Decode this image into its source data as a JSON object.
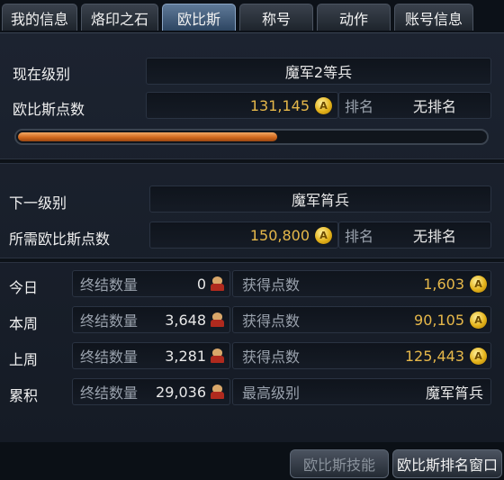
{
  "tabs": [
    {
      "label": "我的信息"
    },
    {
      "label": "烙印之石"
    },
    {
      "label": "欧比斯"
    },
    {
      "label": "称号"
    },
    {
      "label": "动作"
    },
    {
      "label": "账号信息"
    }
  ],
  "active_tab": "欧比斯",
  "current": {
    "level_label": "现在级别",
    "level_value": "魔军2等兵",
    "points_label": "欧比斯点数",
    "points_value": "131,145",
    "rank_label": "排名",
    "rank_value": "无排名",
    "progress_fraction": 0.555
  },
  "next": {
    "level_label": "下一级别",
    "level_value": "魔军筲兵",
    "points_label": "所需欧比斯点数",
    "points_value": "150,800",
    "rank_label": "排名",
    "rank_value": "无排名"
  },
  "stats": {
    "kills_label": "终结数量",
    "gained_label": "获得点数",
    "rows": [
      {
        "period": "今日",
        "kills": "0",
        "points": "1,603"
      },
      {
        "period": "本周",
        "kills": "3,648",
        "points": "90,105"
      },
      {
        "period": "上周",
        "kills": "3,281",
        "points": "125,443"
      }
    ],
    "total": {
      "period": "累积",
      "kills": "29,036",
      "highest_label": "最高级别",
      "highest_value": "魔军筲兵"
    }
  },
  "buttons": {
    "skills": "欧比斯技能",
    "ranking": "欧比斯排名窗口"
  },
  "icons": {
    "coin": "A"
  },
  "colors": {
    "gold": "#e6b84a",
    "progress": "#d2691e",
    "active_tab": "#4a6a8f"
  }
}
